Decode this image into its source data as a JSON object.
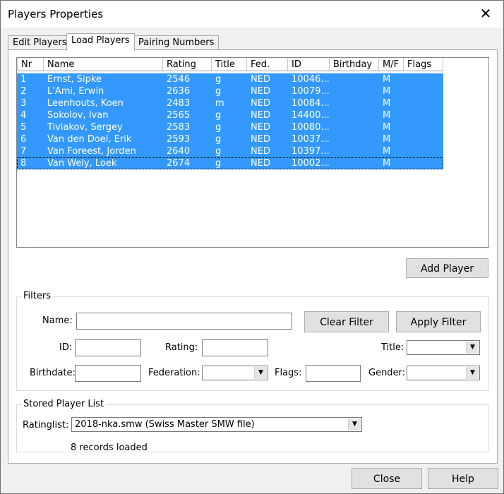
{
  "window": {
    "title": "Players Properties",
    "close_glyph": "✕"
  },
  "tabs": [
    {
      "label": "Edit Players",
      "active": false
    },
    {
      "label": "Load Players",
      "active": true
    },
    {
      "label": "Pairing Numbers",
      "active": false
    }
  ],
  "grid": {
    "columns": [
      "Nr",
      "Name",
      "Rating",
      "Title",
      "Fed.",
      "ID",
      "Birthday",
      "M/F",
      "Flags"
    ],
    "rows": [
      {
        "nr": "1",
        "name": "Ernst, Sipke",
        "rating": "2546",
        "title": "g",
        "fed": "NED",
        "id": "10046...",
        "birthday": "",
        "mf": "M",
        "flags": ""
      },
      {
        "nr": "2",
        "name": "L'Ami, Erwin",
        "rating": "2636",
        "title": "g",
        "fed": "NED",
        "id": "10079...",
        "birthday": "",
        "mf": "M",
        "flags": ""
      },
      {
        "nr": "3",
        "name": "Leenhouts, Koen",
        "rating": "2483",
        "title": "m",
        "fed": "NED",
        "id": "10084...",
        "birthday": "",
        "mf": "M",
        "flags": ""
      },
      {
        "nr": "4",
        "name": "Sokolov, Ivan",
        "rating": "2565",
        "title": "g",
        "fed": "NED",
        "id": "14400...",
        "birthday": "",
        "mf": "M",
        "flags": ""
      },
      {
        "nr": "5",
        "name": "Tiviakov, Sergey",
        "rating": "2583",
        "title": "g",
        "fed": "NED",
        "id": "10080...",
        "birthday": "",
        "mf": "M",
        "flags": ""
      },
      {
        "nr": "6",
        "name": "Van den Doel, Erik",
        "rating": "2593",
        "title": "g",
        "fed": "NED",
        "id": "10037...",
        "birthday": "",
        "mf": "M",
        "flags": ""
      },
      {
        "nr": "7",
        "name": "Van Foreest, Jorden",
        "rating": "2640",
        "title": "g",
        "fed": "NED",
        "id": "10397...",
        "birthday": "",
        "mf": "M",
        "flags": ""
      },
      {
        "nr": "8",
        "name": "Van Wely, Loek",
        "rating": "2674",
        "title": "g",
        "fed": "NED",
        "id": "10002...",
        "birthday": "",
        "mf": "M",
        "flags": ""
      }
    ],
    "selection_color": "#3399ff"
  },
  "buttons": {
    "add_player": "Add Player",
    "clear_filter": "Clear Filter",
    "apply_filter": "Apply Filter",
    "close": "Close",
    "help": "Help"
  },
  "filters": {
    "group_label": "Filters",
    "name_label": "Name:",
    "name_value": "",
    "id_label": "ID:",
    "id_value": "",
    "rating_label": "Rating:",
    "rating_value": "",
    "title_label": "Title:",
    "title_value": "",
    "birthdate_label": "Birthdate:",
    "birthdate_value": "",
    "federation_label": "Federation:",
    "federation_value": "",
    "flags_label": "Flags:",
    "flags_value": "",
    "gender_label": "Gender:",
    "gender_value": ""
  },
  "stored_list": {
    "group_label": "Stored Player List",
    "ratinglist_label": "Ratinglist:",
    "ratinglist_value": "2018-nka.smw (Swiss Master SMW file)",
    "status": "8 records loaded"
  }
}
